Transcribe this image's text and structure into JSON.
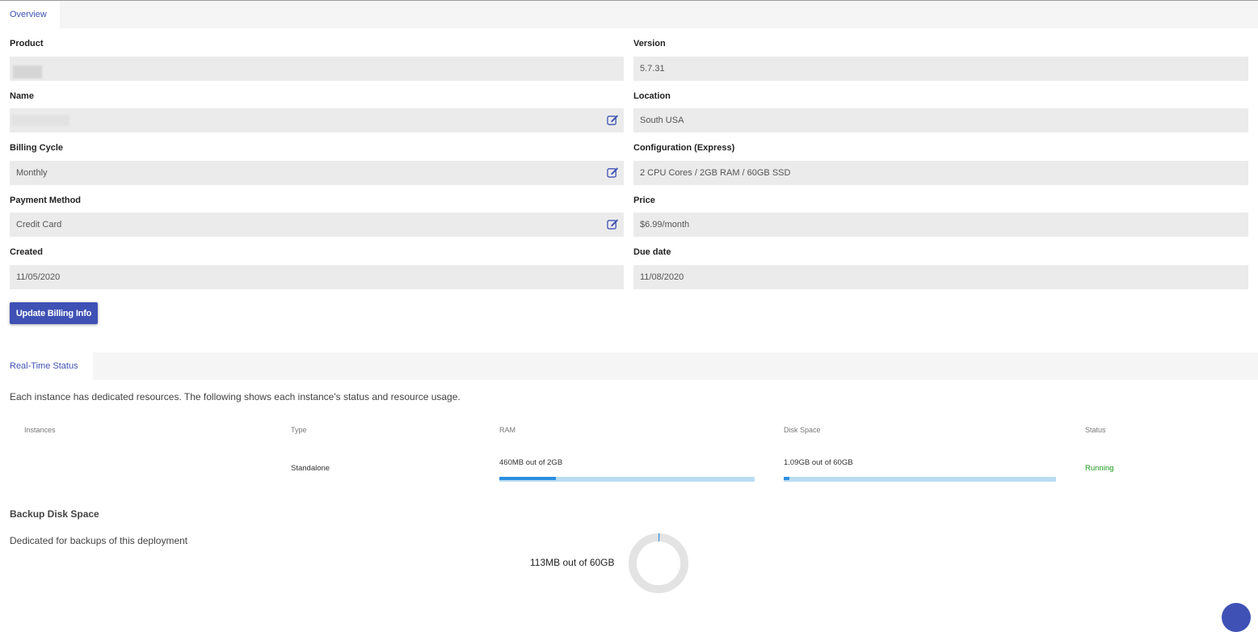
{
  "tabs": {
    "overview": "Overview",
    "realtime": "Real-Time Status"
  },
  "overview": {
    "product_label": "Product",
    "version_label": "Version",
    "version_value": "5.7.31",
    "name_label": "Name",
    "location_label": "Location",
    "location_value": "South USA",
    "billing_cycle_label": "Billing Cycle",
    "billing_cycle_value": "Monthly",
    "configuration_label": "Configuration (Express)",
    "configuration_value": "2 CPU Cores / 2GB RAM / 60GB SSD",
    "payment_method_label": "Payment Method",
    "payment_method_value": "Credit Card",
    "price_label": "Price",
    "price_value": "$6.99/month",
    "created_label": "Created",
    "created_value": "11/05/2020",
    "due_date_label": "Due date",
    "due_date_value": "11/08/2020",
    "update_button": "Update Billing Info"
  },
  "realtime": {
    "description": "Each instance has dedicated resources. The following shows each instance's status and resource usage.",
    "columns": [
      "Instances",
      "Type",
      "RAM",
      "Disk Space",
      "Status"
    ],
    "rows": [
      {
        "instance": "",
        "type": "Standalone",
        "ram_text": "460MB out of 2GB",
        "ram_fraction": 0.22,
        "disk_text": "1.09GB out of 60GB",
        "disk_fraction": 0.018,
        "status": "Running"
      }
    ]
  },
  "backup": {
    "title": "Backup Disk Space",
    "description": "Dedicated for backups of this deployment",
    "usage_text": "113MB out of 60GB",
    "used_fraction": 0.0019
  },
  "colors": {
    "accent": "#3f51b5",
    "progress": "#2d8ee0",
    "progress_track": "#b9dcf3",
    "running": "#1a9a1a"
  },
  "icons": {
    "edit": "edit-icon"
  }
}
